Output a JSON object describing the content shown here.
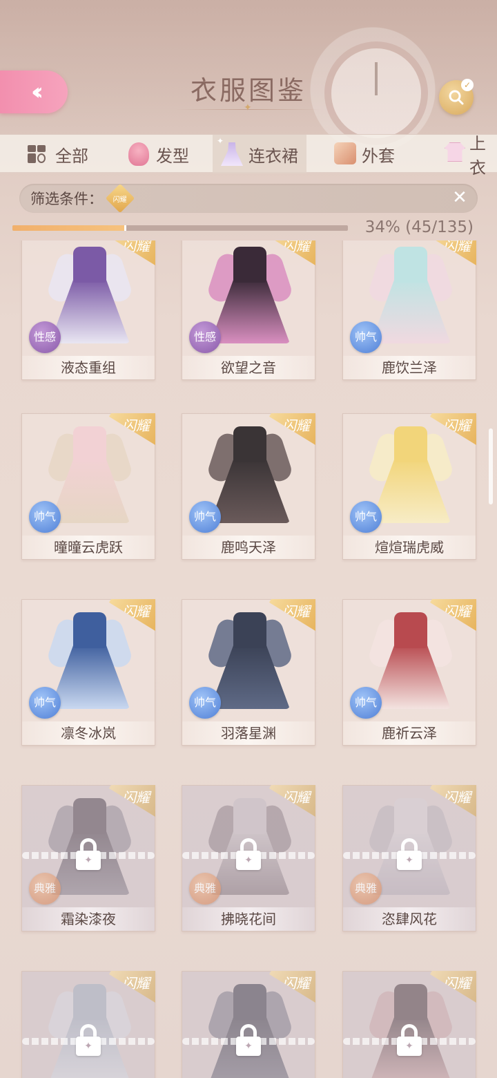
{
  "header": {
    "title": "衣服图鉴",
    "back_icon": "double-chevron-left-icon",
    "search_icon": "search-icon"
  },
  "tabs": [
    {
      "label": "全部",
      "icon": "grid-icon",
      "active": false
    },
    {
      "label": "发型",
      "icon": "hair-icon",
      "active": false
    },
    {
      "label": "连衣裙",
      "icon": "dress-icon",
      "active": true
    },
    {
      "label": "外套",
      "icon": "coat-icon",
      "active": false
    },
    {
      "label": "上衣",
      "icon": "top-icon",
      "active": false
    }
  ],
  "filter": {
    "label": "筛选条件：",
    "tag": "闪耀"
  },
  "progress": {
    "text": "34% (45/135)",
    "fraction": 0.34
  },
  "rarity_label": "闪耀",
  "styles": {
    "sexy": "性感",
    "cool": "帅气",
    "elegant": "典雅"
  },
  "items": [
    {
      "name": "液态重组",
      "style": "性感",
      "locked": false,
      "colors": [
        "#7b5aa6",
        "#e9e6f2"
      ]
    },
    {
      "name": "欲望之音",
      "style": "性感",
      "locked": false,
      "colors": [
        "#3a2a38",
        "#d98fc0"
      ]
    },
    {
      "name": "鹿饮兰泽",
      "style": "帅气",
      "locked": false,
      "colors": [
        "#bfe3e3",
        "#f0d9e0"
      ]
    },
    {
      "name": "曈曈云虎跃",
      "style": "帅气",
      "locked": false,
      "colors": [
        "#f2d1d4",
        "#e6d6c4"
      ]
    },
    {
      "name": "鹿鸣天泽",
      "style": "帅气",
      "locked": false,
      "colors": [
        "#3a3436",
        "#6a5a5a"
      ]
    },
    {
      "name": "煊煊瑞虎威",
      "style": "帅气",
      "locked": false,
      "colors": [
        "#f2d57a",
        "#f7ecc6"
      ]
    },
    {
      "name": "凛冬冰岚",
      "style": "帅气",
      "locked": false,
      "colors": [
        "#3f5f9e",
        "#c9d8f0"
      ]
    },
    {
      "name": "羽落星渊",
      "style": "帅气",
      "locked": false,
      "colors": [
        "#3b4256",
        "#5f6a86"
      ]
    },
    {
      "name": "鹿祈云泽",
      "style": "帅气",
      "locked": false,
      "colors": [
        "#b84a4f",
        "#f3e3e0"
      ]
    },
    {
      "name": "霜染漆夜",
      "style": "典雅",
      "locked": true,
      "colors": [
        "#5a4f5c",
        "#8e8692"
      ]
    },
    {
      "name": "拂晓花间",
      "style": "典雅",
      "locked": true,
      "colors": [
        "#c9c0c6",
        "#8c7e86"
      ]
    },
    {
      "name": "恣肆风花",
      "style": "典雅",
      "locked": true,
      "colors": [
        "#d9d2d8",
        "#b9b0ba"
      ]
    },
    {
      "name": "",
      "style": "",
      "locked": true,
      "colors": [
        "#a9b3c4",
        "#d8dbe4"
      ]
    },
    {
      "name": "",
      "style": "",
      "locked": true,
      "colors": [
        "#4d4b5a",
        "#7b7888"
      ]
    },
    {
      "name": "",
      "style": "",
      "locked": true,
      "colors": [
        "#5a4a52",
        "#c9a4a8"
      ]
    }
  ]
}
